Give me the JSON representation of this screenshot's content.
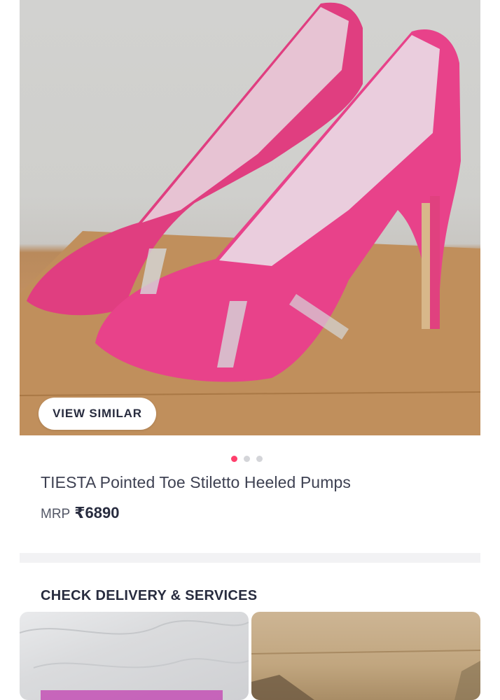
{
  "product": {
    "view_similar_label": "VIEW SIMILAR",
    "title": "TIESTA Pointed Toe Stiletto Heeled Pumps",
    "mrp_label": "MRP",
    "price": "₹6890",
    "image_count": 3,
    "active_image_index": 0
  },
  "delivery": {
    "section_title": "CHECK DELIVERY & SERVICES"
  },
  "colors": {
    "accent": "#ff3f6c",
    "shoe_pink": "#e23d7f"
  }
}
